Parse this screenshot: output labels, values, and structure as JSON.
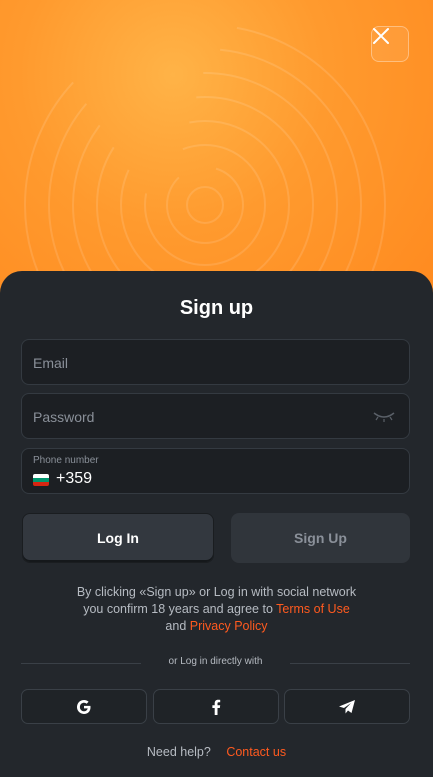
{
  "hero": {
    "close_icon": "close-icon"
  },
  "form": {
    "title": "Sign up",
    "email_placeholder": "Email",
    "password_placeholder": "Password",
    "phone_label": "Phone number",
    "phone_code": "+359",
    "flag": "bulgaria-flag",
    "eye_icon": "eye-closed-icon"
  },
  "tabs": {
    "login": "Log In",
    "signup": "Sign Up"
  },
  "terms": {
    "line1": "By clicking «Sign up» or Log in with social network",
    "line2": "you confirm 18 years and agree to",
    "terms_link": "Terms of Use",
    "and": "and",
    "privacy_link": "Privacy Policy"
  },
  "divider": "or Log in directly with",
  "social": [
    "google-icon",
    "facebook-icon",
    "telegram-icon"
  ],
  "help": {
    "text": "Need help?",
    "link": "Contact us"
  },
  "colors": {
    "accent": "#ff5a1f",
    "hero": "#ff9a2e",
    "background": "#23272c"
  }
}
